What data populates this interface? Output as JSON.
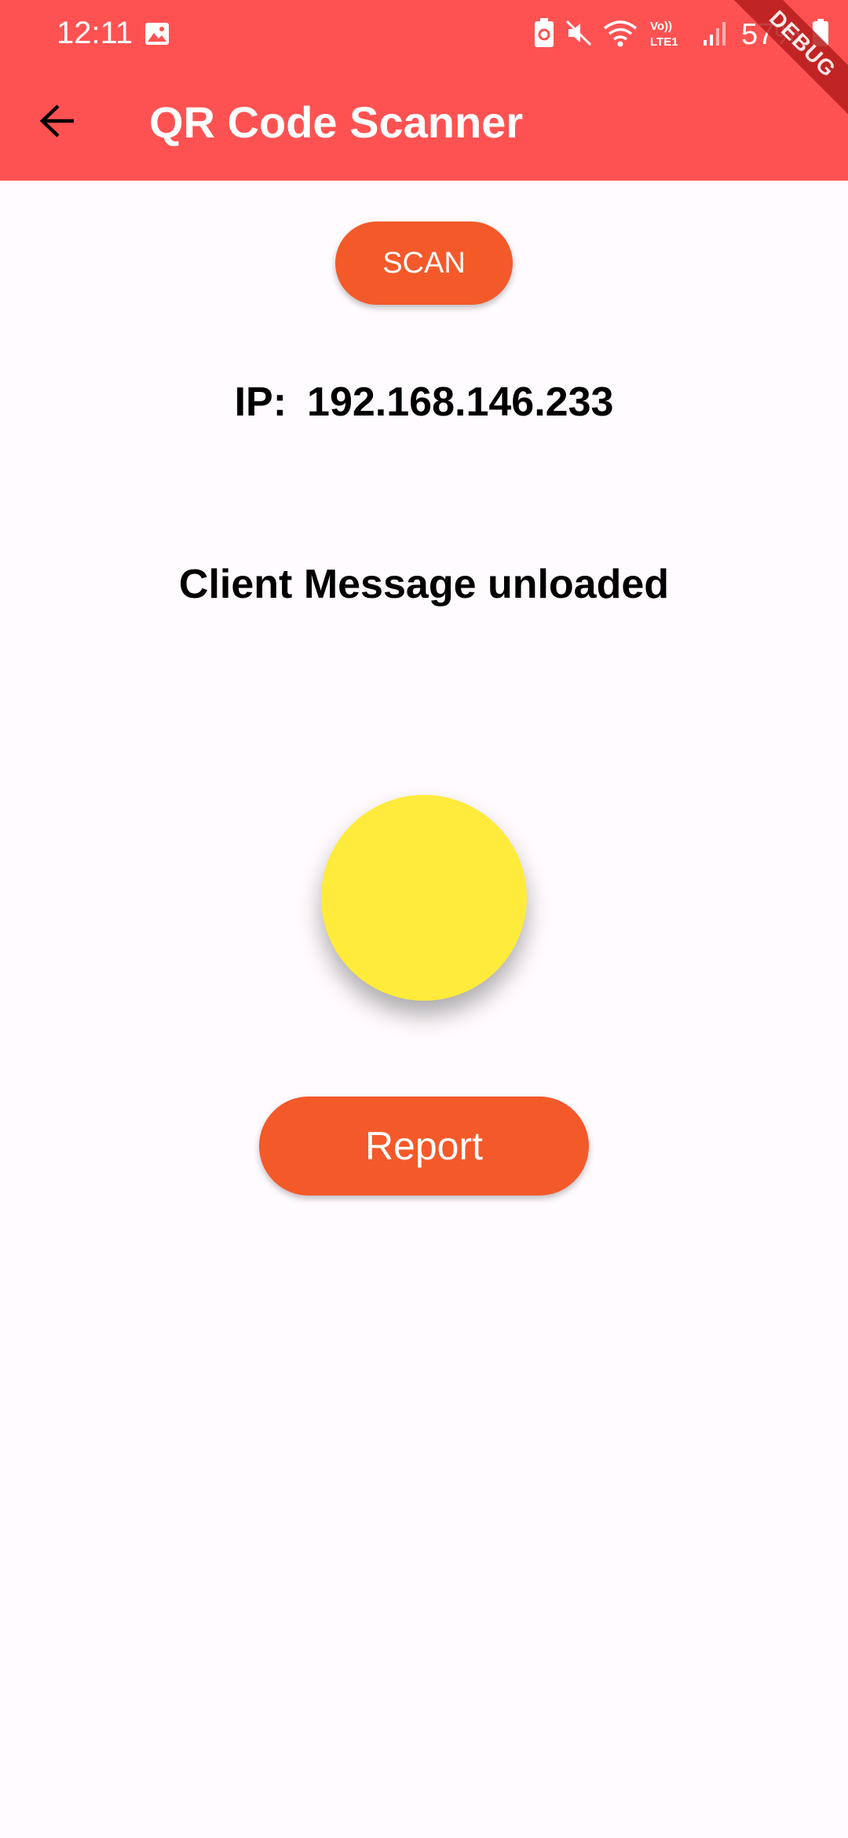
{
  "status_bar": {
    "time": "12:11",
    "battery_percent": "57%",
    "network_label": "Vo)) LTE1",
    "icons": [
      "gallery-icon",
      "battery-saver-icon",
      "mute-icon",
      "wifi-icon",
      "lte-icon",
      "signal-icon",
      "battery-icon"
    ]
  },
  "app_bar": {
    "title": "QR Code Scanner",
    "back_icon": "arrow-left-icon",
    "background": "#fe5252"
  },
  "debug_banner": {
    "label": "DEBUG"
  },
  "main": {
    "scan_button_label": "SCAN",
    "ip_label": "IP:",
    "ip_value": "192.168.146.233",
    "client_message": "Client Message unloaded",
    "indicator_color": "#ffeb3b",
    "report_button_label": "Report",
    "button_color": "#f4592a"
  }
}
